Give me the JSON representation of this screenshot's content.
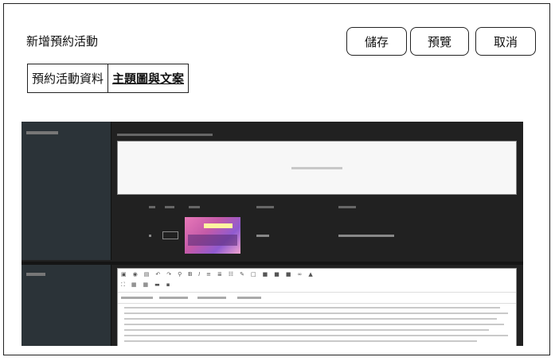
{
  "header": {
    "title": "新增預約活動",
    "buttons": {
      "save": "儲存",
      "preview": "預覽",
      "cancel": "取消"
    }
  },
  "tabs": [
    {
      "label": "預約活動資料",
      "active": false
    },
    {
      "label": "主題圖與文案",
      "active": true
    }
  ],
  "theme": {
    "accent": "#222222",
    "panel_bg": "#212121",
    "sidebar_bg": "#2b3338"
  }
}
